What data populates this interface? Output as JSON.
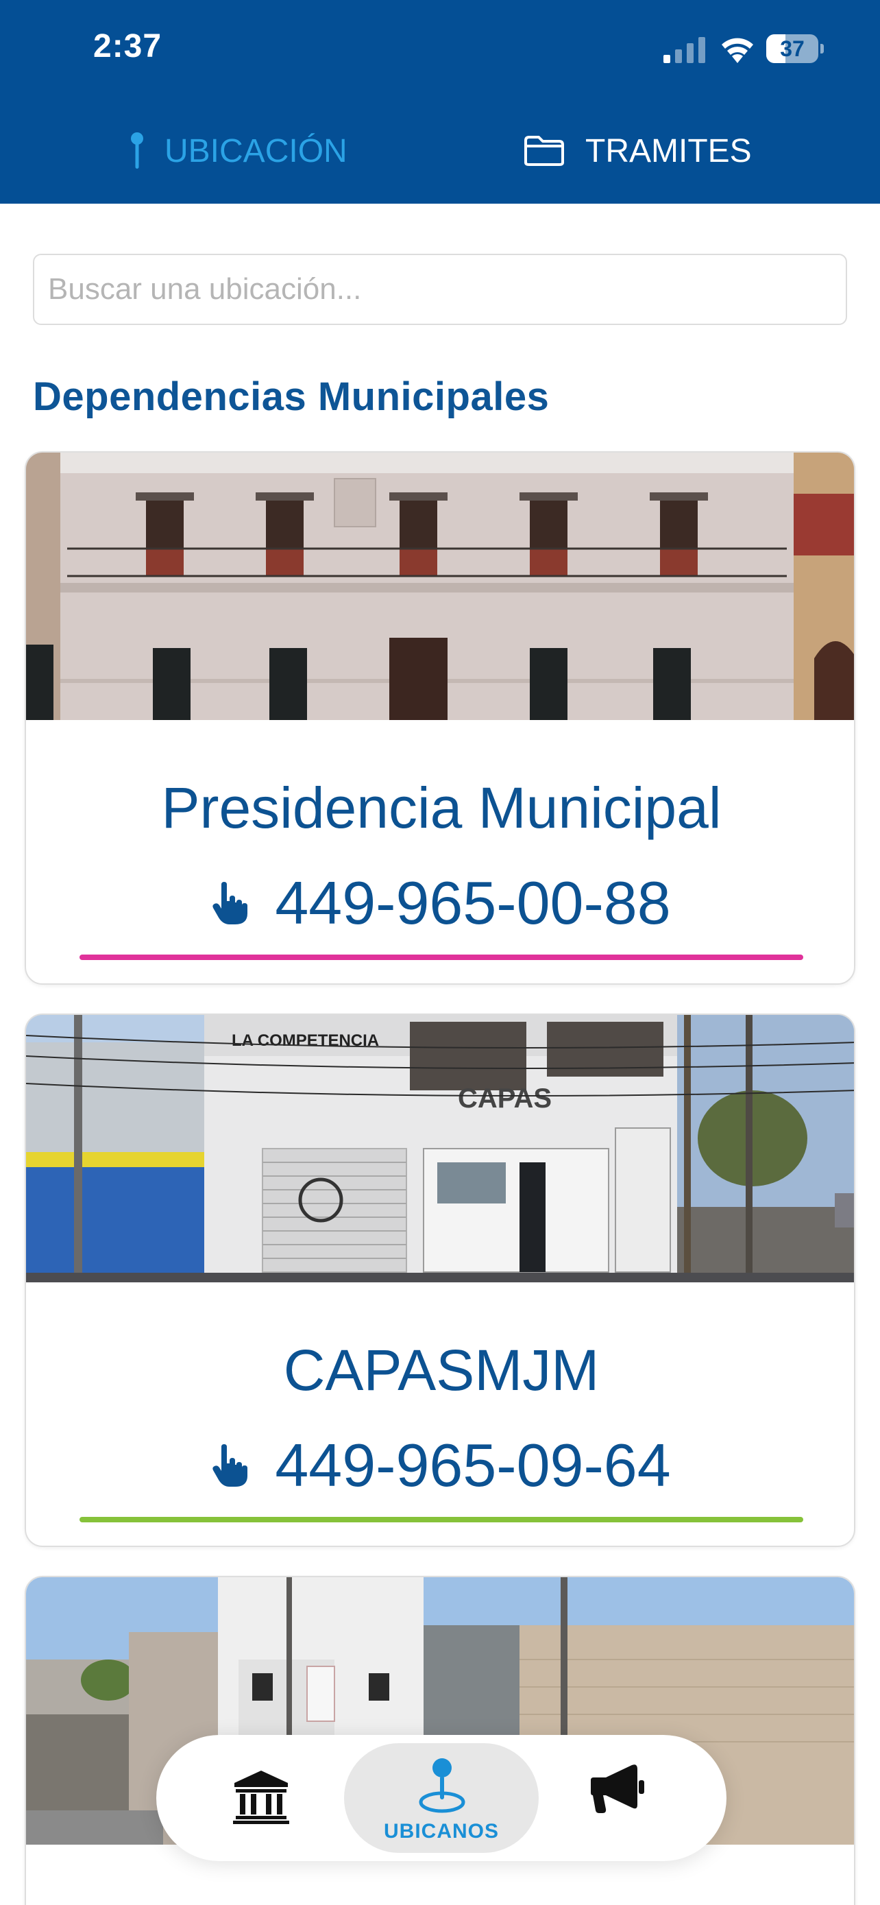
{
  "status_bar": {
    "time": "2:37",
    "battery_level": "37",
    "battery_fraction": 0.37
  },
  "top_tabs": [
    {
      "label": "UBICACIÓN",
      "icon": "pin-icon",
      "active": true
    },
    {
      "label": "TRAMITES",
      "icon": "folder-icon",
      "active": false
    }
  ],
  "search": {
    "placeholder": "Buscar una ubicación...",
    "value": ""
  },
  "section_title": "Dependencias Municipales",
  "cards": [
    {
      "name": "Presidencia Municipal",
      "phone": "449-965-00-88",
      "accent": "#e0329a",
      "icon": "hand-pointer-icon"
    },
    {
      "name": "CAPASMJM",
      "phone": "449-965-09-64",
      "accent": "#86c23a",
      "icon": "hand-pointer-icon"
    },
    {
      "name": "",
      "phone": "",
      "accent": "",
      "icon": ""
    }
  ],
  "bottom_nav": {
    "items": [
      {
        "icon": "building-columns-icon",
        "label": ""
      },
      {
        "icon": "location-pin-icon",
        "label": "UBICANOS",
        "active": true
      },
      {
        "icon": "megaphone-icon",
        "label": ""
      }
    ]
  },
  "colors": {
    "header_bg": "#044f95",
    "active_tab": "#2ba3e6",
    "title": "#0e5596",
    "text_primary": "#0c5292"
  }
}
